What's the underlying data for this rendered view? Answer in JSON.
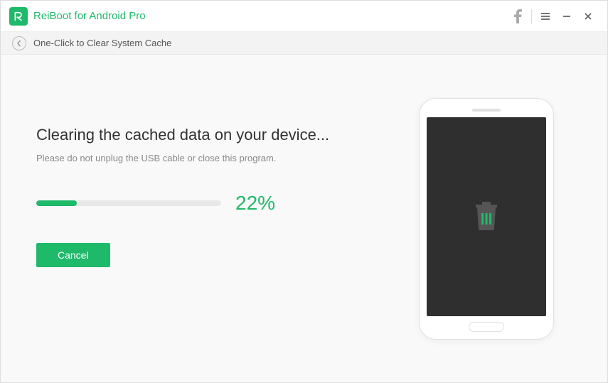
{
  "titlebar": {
    "app_name": "ReiBoot for Android Pro"
  },
  "subheader": {
    "breadcrumb": "One-Click to Clear System Cache"
  },
  "main": {
    "heading": "Clearing the cached data on your device...",
    "subtext": "Please do not unplug the USB cable or close this program.",
    "progress_percent": 22,
    "progress_label": "22%",
    "cancel_label": "Cancel"
  },
  "colors": {
    "accent": "#1fb96a"
  }
}
